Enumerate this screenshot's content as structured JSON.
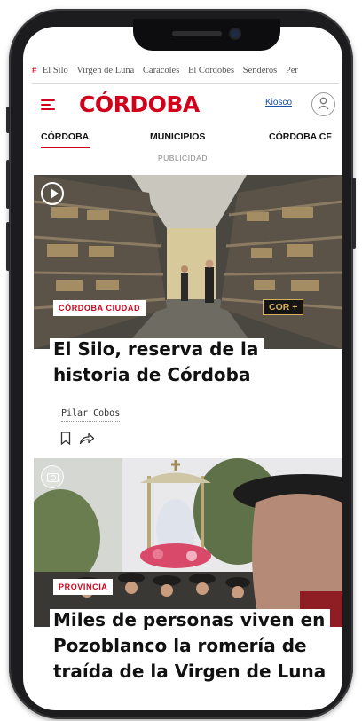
{
  "tags_bar": {
    "hash": "#",
    "items": [
      "El Silo",
      "Virgen de Luna",
      "Caracoles",
      "El Cordobés",
      "Senderos",
      "Per"
    ]
  },
  "header": {
    "logo": "CÓRDOBA",
    "kiosco": "Kiosco"
  },
  "nav": {
    "items": [
      "CÓRDOBA",
      "MUNICIPIOS",
      "CÓRDOBA CF"
    ],
    "active": 0
  },
  "ad_label": "PUBLICIDAD",
  "articles": [
    {
      "section": "CÓRDOBA CIUDAD",
      "badge": "COR +",
      "headline": "El Silo, reserva de la historia de Córdoba",
      "author": "Pilar Cobos",
      "media": "video"
    },
    {
      "section": "PROVINCIA",
      "headline": "Miles de personas viven en Pozoblanco la romería de traída de la Virgen de Luna",
      "media": "gallery"
    }
  ],
  "colors": {
    "brand": "#d0021b",
    "link": "#1a4fa3",
    "frame": "#1c1c1e",
    "badge_gold": "#d6b25e"
  },
  "icons": [
    "menu-icon",
    "user-icon",
    "play-icon",
    "camera-icon",
    "bookmark-icon",
    "share-icon"
  ]
}
